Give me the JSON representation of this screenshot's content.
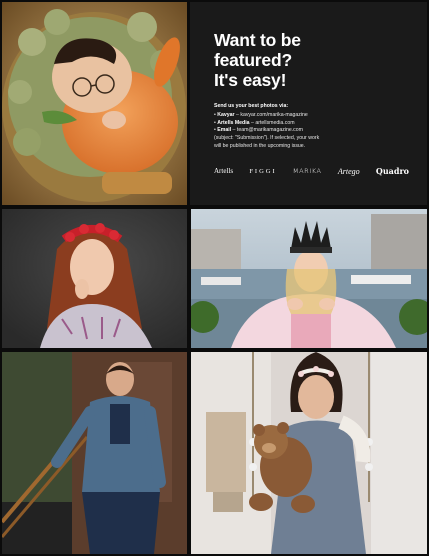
{
  "panel": {
    "headline_line1": "Want to be",
    "headline_line2": "featured?",
    "headline_line3": "It's easy!",
    "lead": "Send us your best photos via:",
    "item1_label": "Kavyar",
    "item1_text": " – kavyar.com/marika-magazine",
    "item2_label": "Artells Media",
    "item2_text": " – artellsmedia.com",
    "item3_label": "Email",
    "item3_text": " – team@marikamagazine.com",
    "note_line1": "(subject: \"Submission\"). If selected, your work",
    "note_line2": "will be published in the upcoming issue."
  },
  "logos": {
    "artells": "Artells",
    "figgi": "FIGGI",
    "marika": "MARIKA",
    "artego": "Artego",
    "quadro": "Quadro"
  },
  "photos": [
    {
      "name": "newborn-photo",
      "subject": "sleeping newborn with glasses in orange wrap"
    },
    {
      "name": "red-hair-girl-photo",
      "subject": "girl with red flower crown"
    },
    {
      "name": "crown-girl-photo",
      "subject": "girl with black crown by the harbor"
    },
    {
      "name": "denim-boy-photo",
      "subject": "boy in denim jacket on stairs"
    },
    {
      "name": "teddy-bear-girl-photo",
      "subject": "girl holding teddy bear on swing"
    }
  ],
  "colors": {
    "background": "#0b0b0b",
    "panel": "#1a1a1a",
    "text": "#ffffff"
  }
}
